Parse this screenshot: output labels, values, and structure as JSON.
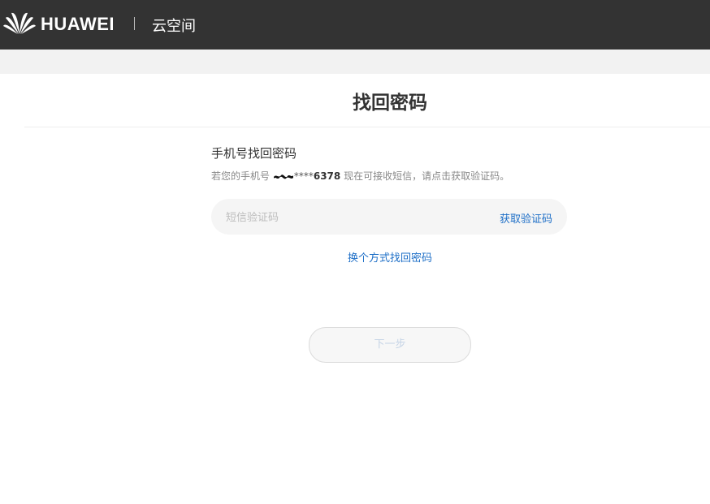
{
  "header": {
    "brand": "HUAWEI",
    "product": "云空间",
    "logo_icon": "huawei-petal-logo-icon"
  },
  "main": {
    "title": "找回密码",
    "section_title": "手机号找回密码",
    "hint_prefix": "若您的手机号",
    "masked_digits": "****",
    "phone_suffix": "6378",
    "hint_suffix": " 现在可接收短信，请点击获取验证码。",
    "code_input": {
      "placeholder": "短信验证码",
      "value": ""
    },
    "get_code_label": "获取验证码",
    "switch_method_label": "换个方式找回密码",
    "next_button_label": "下一步"
  },
  "colors": {
    "header_bg": "#333333",
    "link": "#1e6fc7",
    "input_bg": "#f5f5f5",
    "disabled_text": "#c6d4e6"
  }
}
